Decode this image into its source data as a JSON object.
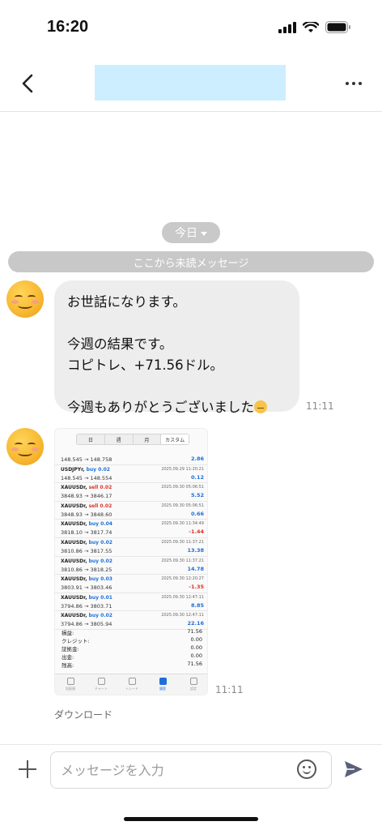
{
  "status_bar": {
    "time": "16:20"
  },
  "header": {
    "contact_name": ""
  },
  "chat": {
    "date_label": "今日",
    "unread_divider": "ここから未読メッセージ",
    "message1": {
      "lines": [
        "お世話になります。",
        "今週の結果です。",
        "コピトレ、+71.56ドル。",
        "今週もありがとうございました"
      ],
      "time": "11:11"
    },
    "message2": {
      "time": "11:11",
      "download_label": "ダウンロード",
      "image": {
        "tabs": [
          "日",
          "週",
          "月",
          "カスタム"
        ],
        "trades": [
          {
            "symbol": "",
            "side": "",
            "prices": "148.545 → 148.758",
            "datetime": "",
            "profit": "2.86",
            "profit_color": "#1e6fd9"
          },
          {
            "symbol": "USDJPYr,",
            "side": "buy 0.02",
            "side_color": "#1e6fd9",
            "prices": "148.545 → 148.554",
            "datetime": "2025.09.29 11:20:21",
            "profit": "0.12",
            "profit_color": "#1e6fd9"
          },
          {
            "symbol": "XAUUSDr,",
            "side": "sell 0.02",
            "side_color": "#d9342b",
            "prices": "3848.93 → 3846.17",
            "datetime": "2025.09.30 05:06:51",
            "profit": "5.52",
            "profit_color": "#1e6fd9"
          },
          {
            "symbol": "XAUUSDr,",
            "side": "sell 0.02",
            "side_color": "#d9342b",
            "prices": "3848.93 → 3848.60",
            "datetime": "2025.09.30 05:06:51",
            "profit": "0.66",
            "profit_color": "#1e6fd9"
          },
          {
            "symbol": "XAUUSDr,",
            "side": "buy 0.04",
            "side_color": "#1e6fd9",
            "prices": "3818.10 → 3817.74",
            "datetime": "2025.09.30 11:34:49",
            "profit": "-1.44",
            "profit_color": "#d9342b"
          },
          {
            "symbol": "XAUUSDr,",
            "side": "buy 0.02",
            "side_color": "#1e6fd9",
            "prices": "3810.86 → 3817.55",
            "datetime": "2025.09.30 11:37:21",
            "profit": "13.38",
            "profit_color": "#1e6fd9"
          },
          {
            "symbol": "XAUUSDr,",
            "side": "buy 0.02",
            "side_color": "#1e6fd9",
            "prices": "3810.86 → 3818.25",
            "datetime": "2025.09.30 11:37:21",
            "profit": "14.78",
            "profit_color": "#1e6fd9"
          },
          {
            "symbol": "XAUUSDr,",
            "side": "buy 0.03",
            "side_color": "#1e6fd9",
            "prices": "3803.91 → 3803.46",
            "datetime": "2025.09.30 12:20:27",
            "profit": "-1.35",
            "profit_color": "#d9342b"
          },
          {
            "symbol": "XAUUSDr,",
            "side": "buy 0.01",
            "side_color": "#1e6fd9",
            "prices": "3794.86 → 3803.71",
            "datetime": "2025.09.30 12:47:11",
            "profit": "8.85",
            "profit_color": "#1e6fd9"
          },
          {
            "symbol": "XAUUSDr,",
            "side": "buy 0.02",
            "side_color": "#1e6fd9",
            "prices": "3794.86 → 3805.94",
            "datetime": "2025.09.30 12:47:11",
            "profit": "22.16",
            "profit_color": "#1e6fd9"
          }
        ],
        "summary": [
          {
            "label": "損益:",
            "value": "71.56"
          },
          {
            "label": "クレジット:",
            "value": "0.00"
          },
          {
            "label": "証拠金:",
            "value": "0.00"
          },
          {
            "label": "出金:",
            "value": "0.00"
          },
          {
            "label": "残高:",
            "value": "71.56"
          }
        ],
        "nav": [
          "気配値",
          "チャート",
          "トレード",
          "履歴",
          "設定"
        ],
        "nav_active": 3
      }
    }
  },
  "input_bar": {
    "placeholder": "メッセージを入力"
  }
}
